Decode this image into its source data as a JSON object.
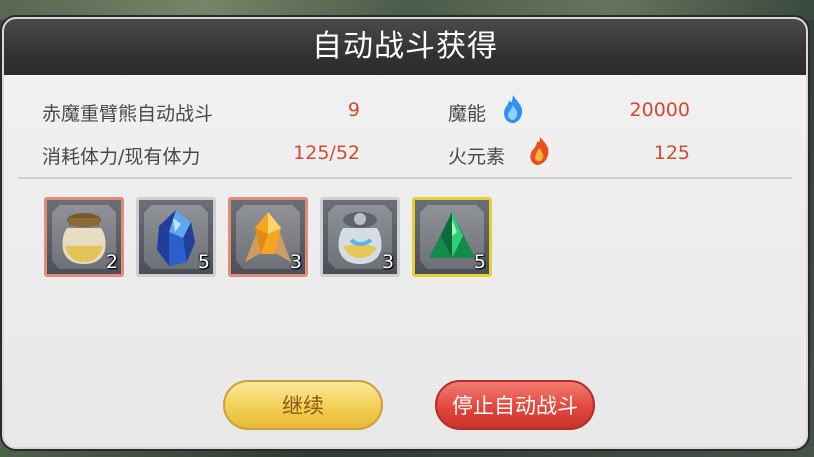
{
  "dialog": {
    "title": "自动战斗获得",
    "stats": {
      "battle_label": "赤魔重臂熊自动战斗",
      "battle_value": "9",
      "stamina_label": "消耗体力/现有体力",
      "stamina_value": "125/52",
      "magic_label": "魔能",
      "magic_value": "20000",
      "fire_label": "火元素",
      "fire_value": "125"
    },
    "items": [
      {
        "icon": "sand-jar-icon",
        "count": "2",
        "frame": "orange"
      },
      {
        "icon": "blue-crystal-icon",
        "count": "5",
        "frame": "gray"
      },
      {
        "icon": "amber-crystal-icon",
        "count": "3",
        "frame": "orange"
      },
      {
        "icon": "glass-jar-icon",
        "count": "3",
        "frame": "gray"
      },
      {
        "icon": "green-gem-icon",
        "count": "5",
        "frame": "gold"
      }
    ],
    "buttons": {
      "continue_label": "继续",
      "stop_label": "停止自动战斗"
    }
  },
  "colors": {
    "value_red": "#d24a32",
    "title_bar": "#333333",
    "continue_button": "#f2cf55",
    "stop_button": "#e2473d"
  }
}
